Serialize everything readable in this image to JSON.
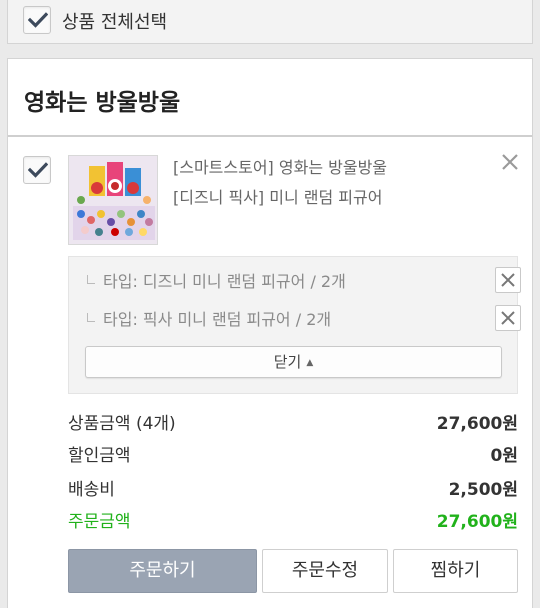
{
  "select_all": {
    "label": "상품 전체선택",
    "checked": true
  },
  "store": {
    "name": "영화는 방울방울"
  },
  "product": {
    "store_tag": "[스마트스토어] 영화는 방울방울",
    "name": "[디즈니 픽사] 미니 랜덤 피규어",
    "checked": true,
    "options": [
      {
        "text": "타입: 디즈니 미니 랜덤 피규어 / 2개"
      },
      {
        "text": "타입: 픽사 미니 랜덤 피규어 / 2개"
      }
    ],
    "fold_label": "닫기",
    "fold_arrow": "▲"
  },
  "summary": {
    "product_amount": {
      "label": "상품금액 (4개)",
      "value": "27,600원"
    },
    "discount": {
      "label": "할인금액",
      "value": "0원"
    },
    "shipping": {
      "label": "배송비",
      "value": "2,500원"
    },
    "total": {
      "label": "주문금액",
      "value": "27,600원"
    }
  },
  "buttons": {
    "order": "주문하기",
    "edit": "주문수정",
    "wish": "찜하기"
  },
  "colors": {
    "accent_green": "#21b21b",
    "order_button": "#9aa4b3",
    "check_mark": "#3d4a5c"
  },
  "icons": {
    "checkbox": "checkmark-icon",
    "remove": "close-icon",
    "option_delete": "x-icon",
    "fold": "triangle-up-icon"
  }
}
